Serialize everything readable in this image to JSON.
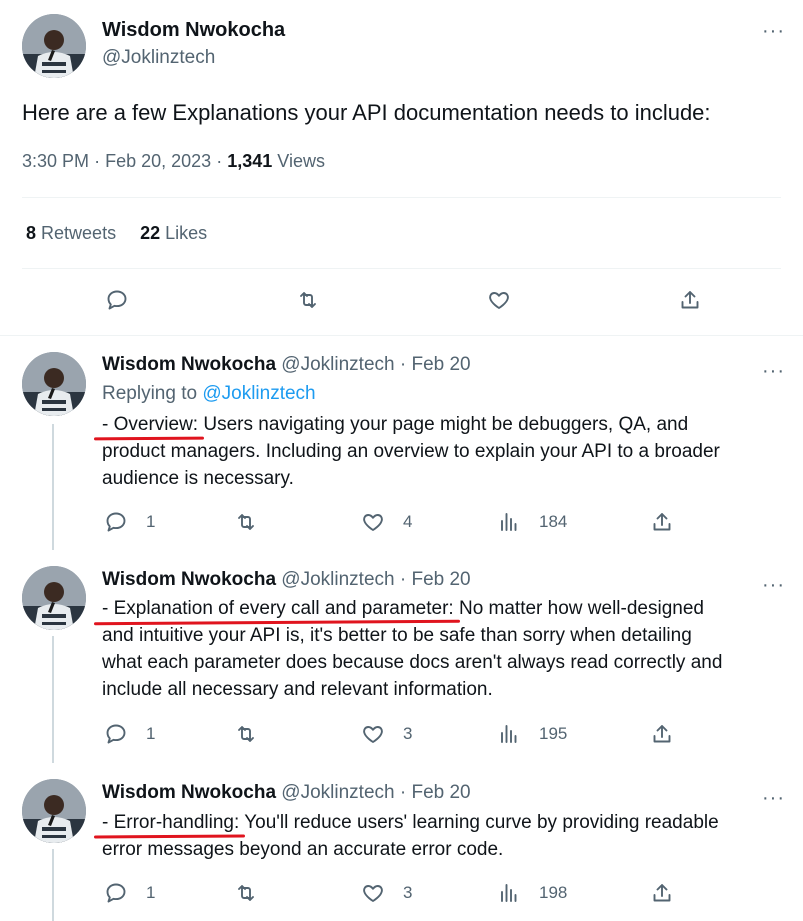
{
  "author": {
    "name": "Wisdom Nwokocha",
    "handle": "@Joklinztech"
  },
  "main_tweet": {
    "text": "Here are a few Explanations your API documentation needs to include:",
    "time": "3:30 PM",
    "date": "Feb 20, 2023",
    "views_count": "1,341",
    "views_label": "Views",
    "retweets_count": "8",
    "retweets_label": "Retweets",
    "likes_count": "22",
    "likes_label": "Likes"
  },
  "more_label": "···",
  "separator": "·",
  "replies": [
    {
      "date": "Feb 20",
      "replying_prefix": "Replying to",
      "replying_handle": "@Joklinztech",
      "highlight": "- Overview:",
      "lines": [
        " Users navigating your page might be debuggers, QA, and",
        "product managers. Including an overview to explain your API to a broader",
        "audience is necessary."
      ],
      "replies": "1",
      "retweets": "",
      "likes": "4",
      "views": "184"
    },
    {
      "date": "Feb 20",
      "highlight": "- Explanation of every call and parameter:",
      "lines": [
        " No matter how well-designed",
        "and intuitive your API is, it's better to be safe than sorry when detailing",
        "what each parameter does because docs aren't always read correctly and",
        "include all necessary and relevant information."
      ],
      "replies": "1",
      "retweets": "",
      "likes": "3",
      "views": "195"
    },
    {
      "date": "Feb 20",
      "highlight": "- Error-handling:",
      "lines": [
        " You'll reduce users' learning curve by providing readable",
        "error messages beyond an accurate error code."
      ],
      "replies": "1",
      "retweets": "",
      "likes": "3",
      "views": "198"
    }
  ],
  "colors": {
    "text": "#0f1419",
    "secondary": "#536471",
    "link": "#1d9bf0",
    "underline": "#e0141e",
    "divider": "#eff3f4"
  }
}
